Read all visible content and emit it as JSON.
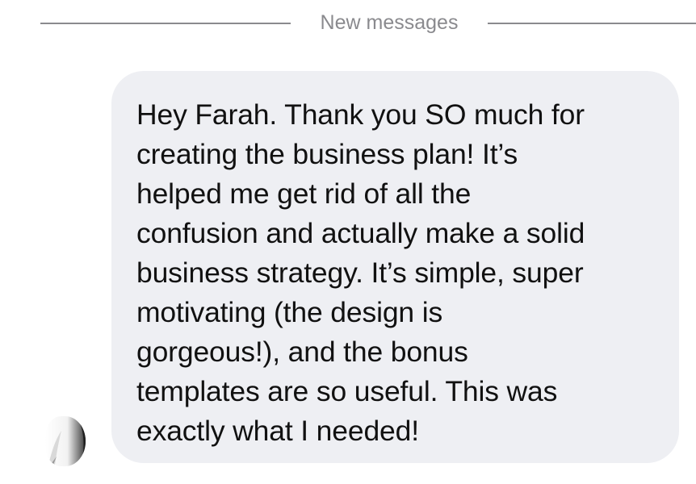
{
  "thread": {
    "divider_label": "New messages"
  },
  "message": {
    "text": "Hey Farah. Thank you SO much for\ncreating the business plan! It’s\nhelped me get rid of all the\nconfusion and actually make a solid\nbusiness strategy. It’s simple, super\nmotivating (the design is\ngorgeous!), and the bonus\ntemplates are so useful. This was\nexactly what I needed!",
    "bubble_color": "#eeeff3",
    "text_color": "#111111"
  },
  "sender": {
    "avatar_icon": "avatar-icon"
  }
}
